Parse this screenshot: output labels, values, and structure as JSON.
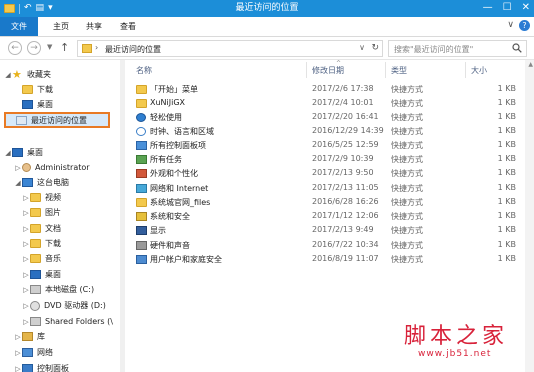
{
  "window": {
    "title": "最近访问的位置",
    "controls": {
      "minimize": "—",
      "maximize": "☐",
      "close": "✕"
    }
  },
  "ribbon": {
    "tabs": [
      {
        "label": "文件",
        "active": true
      },
      {
        "label": "主页"
      },
      {
        "label": "共享"
      },
      {
        "label": "查看"
      }
    ],
    "expand_glyph": "∨",
    "help_glyph": "?"
  },
  "address": {
    "path": "最近访问的位置",
    "search_placeholder": "搜索\"最近访问的位置\"",
    "back_glyph": "←",
    "forward_glyph": "→",
    "up_glyph": "↑"
  },
  "navigation": {
    "items": [
      {
        "label": "收藏夹",
        "icon": "star-icon"
      },
      {
        "label": "下载",
        "icon": "folder-icon"
      },
      {
        "label": "桌面",
        "icon": "desktop-icon"
      },
      {
        "label": "最近访问的位置",
        "icon": "recent-icon",
        "selected": true
      },
      {
        "label": "桌面",
        "icon": "desktop-icon"
      },
      {
        "label": "Administrator",
        "icon": "user-icon"
      },
      {
        "label": "这台电脑",
        "icon": "pc-icon"
      },
      {
        "label": "视频",
        "icon": "folder-icon"
      },
      {
        "label": "图片",
        "icon": "folder-icon"
      },
      {
        "label": "文档",
        "icon": "folder-icon"
      },
      {
        "label": "下载",
        "icon": "folder-icon"
      },
      {
        "label": "音乐",
        "icon": "folder-icon"
      },
      {
        "label": "桌面",
        "icon": "desktop-icon"
      },
      {
        "label": "本地磁盘 (C:)",
        "icon": "drive-icon"
      },
      {
        "label": "DVD 驱动器 (D:)",
        "icon": "dvd-icon"
      },
      {
        "label": "Shared Folders (\\",
        "icon": "network-drive-icon"
      },
      {
        "label": "库",
        "icon": "library-icon"
      },
      {
        "label": "网络",
        "icon": "network-icon"
      },
      {
        "label": "控制面板",
        "icon": "control-panel-icon"
      }
    ]
  },
  "columns": {
    "name": "名称",
    "date": "修改日期",
    "type": "类型",
    "size": "大小"
  },
  "files": [
    {
      "name": "「开始」菜单",
      "date": "2017/2/6 17:38",
      "type": "快捷方式",
      "size": "1 KB",
      "icon": "folder-icon"
    },
    {
      "name": "XuNiJiGX",
      "date": "2017/2/4 10:01",
      "type": "快捷方式",
      "size": "1 KB",
      "icon": "folder-icon"
    },
    {
      "name": "轻松使用",
      "date": "2017/2/20 16:41",
      "type": "快捷方式",
      "size": "1 KB",
      "icon": "accessibility-icon"
    },
    {
      "name": "时钟、语言和区域",
      "date": "2016/12/29 14:39",
      "type": "快捷方式",
      "size": "1 KB",
      "icon": "clock-icon"
    },
    {
      "name": "所有控制面板项",
      "date": "2016/5/25 12:59",
      "type": "快捷方式",
      "size": "1 KB",
      "icon": "control-panel-icon"
    },
    {
      "name": "所有任务",
      "date": "2017/2/9 10:39",
      "type": "快捷方式",
      "size": "1 KB",
      "icon": "tasks-icon"
    },
    {
      "name": "外观和个性化",
      "date": "2017/2/13 9:50",
      "type": "快捷方式",
      "size": "1 KB",
      "icon": "appearance-icon"
    },
    {
      "name": "网络和 Internet",
      "date": "2017/2/13 11:05",
      "type": "快捷方式",
      "size": "1 KB",
      "icon": "network-icon"
    },
    {
      "name": "系统城官网_files",
      "date": "2016/6/28 16:26",
      "type": "快捷方式",
      "size": "1 KB",
      "icon": "folder-icon"
    },
    {
      "name": "系统和安全",
      "date": "2017/1/12 12:06",
      "type": "快捷方式",
      "size": "1 KB",
      "icon": "shield-icon"
    },
    {
      "name": "显示",
      "date": "2017/2/13 9:49",
      "type": "快捷方式",
      "size": "1 KB",
      "icon": "display-icon"
    },
    {
      "name": "硬件和声音",
      "date": "2016/7/22 10:34",
      "type": "快捷方式",
      "size": "1 KB",
      "icon": "hardware-sound-icon"
    },
    {
      "name": "用户帐户和家庭安全",
      "date": "2016/8/19 11:07",
      "type": "快捷方式",
      "size": "1 KB",
      "icon": "users-icon"
    }
  ],
  "watermark": {
    "text": "脚本之家",
    "url": "www.jb51.net"
  }
}
